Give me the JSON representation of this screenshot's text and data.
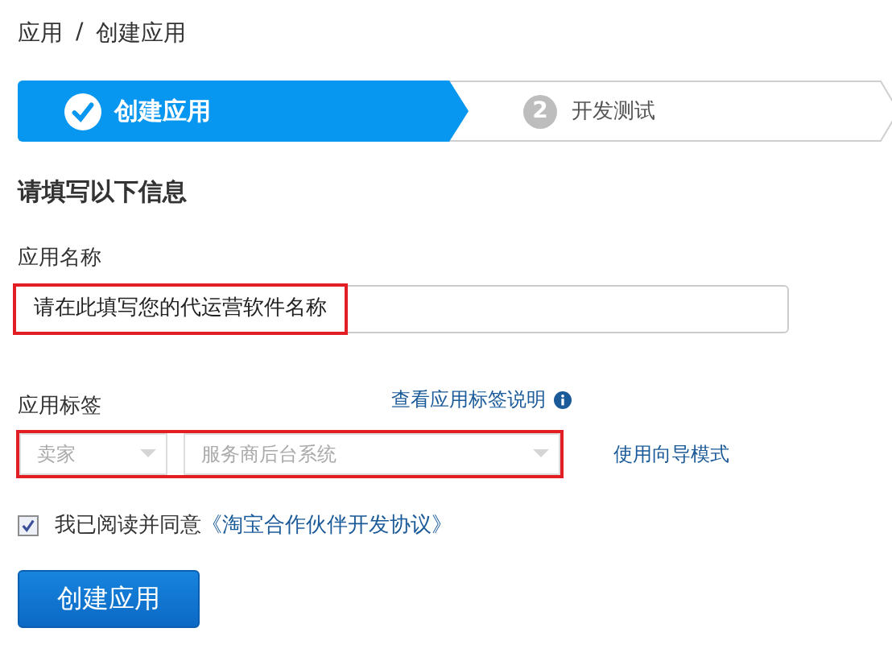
{
  "breadcrumb": [
    "应用",
    "/",
    "创建应用"
  ],
  "steps": [
    {
      "kind": "done",
      "label": "创建应用",
      "selected": true
    },
    {
      "kind": "todo",
      "number": "2",
      "label": "开发测试",
      "selected": false
    }
  ],
  "section_title": "请填写以下信息",
  "app_name": {
    "label": "应用名称",
    "value": "请在此填写您的代运营软件名称",
    "highlighted": true
  },
  "app_tags": {
    "label": "应用标签",
    "help_link": "查看应用标签说明",
    "selects": [
      {
        "placeholder": "卖家"
      },
      {
        "placeholder": "服务商后台系统"
      }
    ],
    "highlighted": true,
    "wizard_link": "使用向导模式"
  },
  "agreement": {
    "checked": true,
    "text": "我已阅读并同意",
    "link": "《淘宝合作伙伴开发协议》"
  },
  "submit_button": "创建应用"
}
